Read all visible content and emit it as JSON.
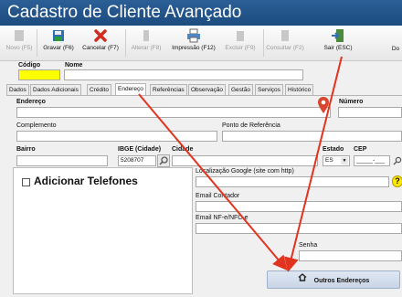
{
  "window": {
    "title": "Cadastro de Cliente Avançado"
  },
  "toolbar": {
    "novo": "Novo (F5)",
    "gravar": "Gravar (F6)",
    "cancelar": "Cancelar (F7)",
    "alterar": "Alterar (F8)",
    "impressao": "Impressão (F12)",
    "excluir": "Excluir (F9)",
    "consultar": "Consultar (F2)",
    "sair": "Sair (ESC)",
    "do": "Do"
  },
  "header": {
    "codigo_label": "Código",
    "nome_label": "Nome",
    "codigo_value": "",
    "nome_value": ""
  },
  "tabs": [
    "Dados",
    "Dados Adicionais",
    "Crédito",
    "Endereço",
    "Referências",
    "Observação",
    "Gestão",
    "Serviços",
    "Histórico"
  ],
  "active_tab": "Endereço",
  "address": {
    "endereco_label": "Endereço",
    "numero_label": "Número",
    "complemento_label": "Complemento",
    "ponto_label": "Ponto de Referência",
    "bairro_label": "Bairro",
    "ibge_label": "IBGE (Cidade)",
    "ibge_value": "5208707",
    "cidade_label": "Cidade",
    "estado_label": "Estado",
    "estado_value": "ES",
    "cep_label": "CEP",
    "cep_value": "_____-___"
  },
  "phones": {
    "label": "Adicionar Telefones"
  },
  "contact": {
    "google_label": "Localização Google (site com http)",
    "help_glyph": "?",
    "email_contador_label": "Email Contador",
    "email_nfe_label": "Email NF-e/NFC-e",
    "senha_label": "Senha"
  },
  "outros_button": "Outros Endereços",
  "colors": {
    "title_bar": "#1c4b7f",
    "codigo_highlight": "#ffff00",
    "arrow": "#e0341e"
  }
}
